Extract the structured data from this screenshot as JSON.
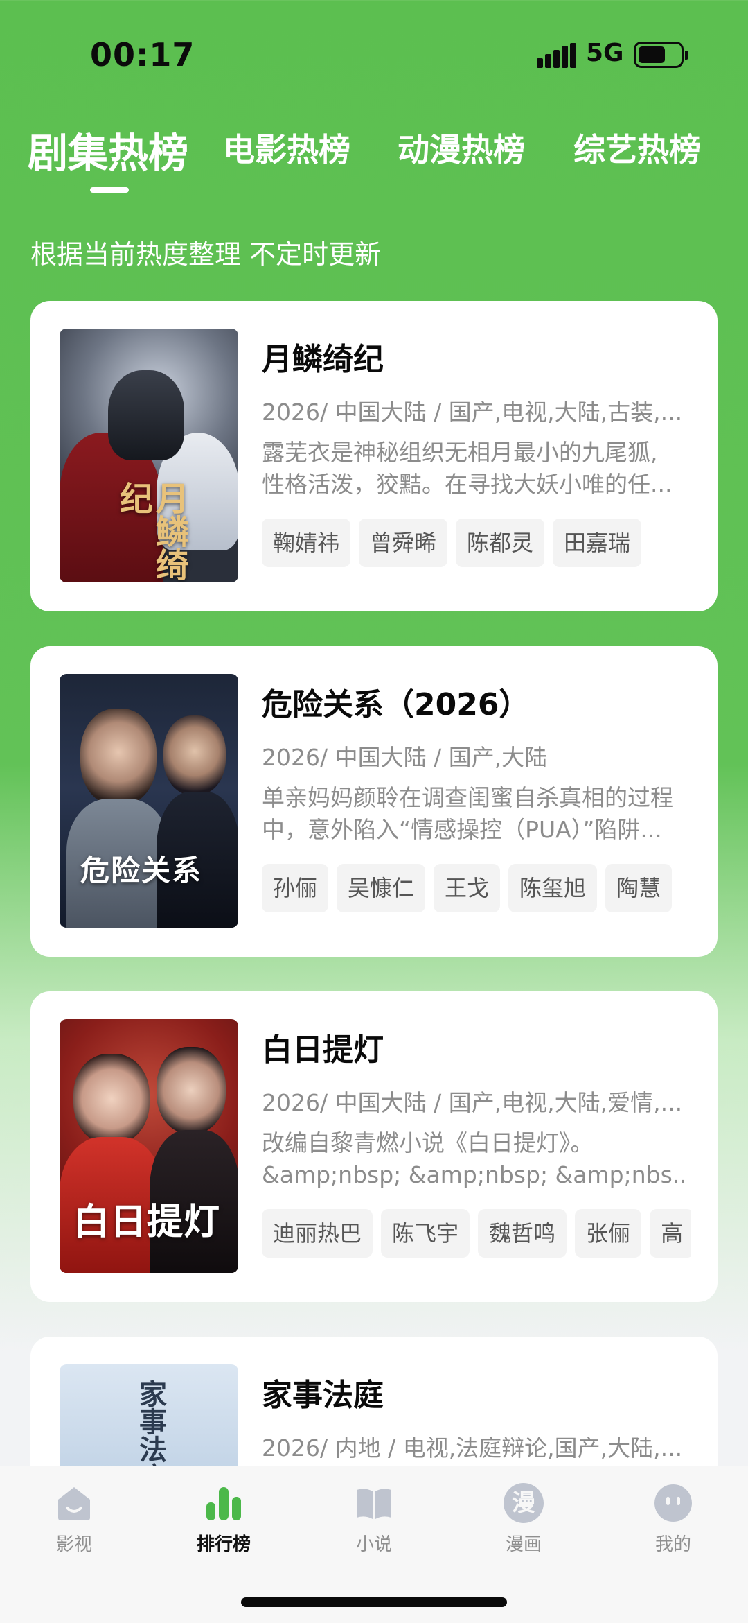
{
  "status_bar": {
    "time": "00:17",
    "network": "5G"
  },
  "tabs": [
    {
      "label": "剧集热榜",
      "active": true
    },
    {
      "label": "电影热榜",
      "active": false
    },
    {
      "label": "动漫热榜",
      "active": false
    },
    {
      "label": "综艺热榜",
      "active": false
    }
  ],
  "subtitle": "根据当前热度整理 不定时更新",
  "cards": [
    {
      "title": "月鳞绮纪",
      "meta": "2026/ 中国大陆 / 国产,电视,大陆,古装,...",
      "desc_line1": "露芜衣是神秘组织无相月最小的九尾狐,",
      "desc_line2": "性格活泼，狡黠。在寻找大妖小唯的任...",
      "poster_text": "月鳞绮纪",
      "tags": [
        "鞠婧祎",
        "曾舜晞",
        "陈都灵",
        "田嘉瑞"
      ]
    },
    {
      "title": "危险关系（2026）",
      "meta": "2026/ 中国大陆 / 国产,大陆",
      "desc_line1": "单亲妈妈颜聆在调查闺蜜自杀真相的过程",
      "desc_line2": "中，意外陷入“情感操控（PUA）”陷阱...",
      "poster_text": "危险关系",
      "tags": [
        "孙俪",
        "吴慷仁",
        "王戈",
        "陈玺旭",
        "陶慧"
      ]
    },
    {
      "title": "白日提灯",
      "meta": "2026/ 中国大陆 / 国产,电视,大陆,爱情,...",
      "desc_line1": "改编自黎青燃小说《白日提灯》。",
      "desc_line2": "&amp;nbsp; &amp;nbsp; &amp;nbs...",
      "poster_text": "白日提灯",
      "tags": [
        "迪丽热巴",
        "陈飞宇",
        "魏哲鸣",
        "张俪",
        "高"
      ]
    },
    {
      "title": "家事法庭",
      "meta": "2026/ 内地 / 电视,法庭辩论,国产,大陆,...",
      "desc_line1": "",
      "desc_line2": "",
      "poster_text": "家事法庭",
      "tags": []
    }
  ],
  "bottom_nav": [
    {
      "label": "影视",
      "icon": "home-icon",
      "active": false
    },
    {
      "label": "排行榜",
      "icon": "ranking-bars-icon",
      "active": true
    },
    {
      "label": "小说",
      "icon": "book-icon",
      "active": false
    },
    {
      "label": "漫画",
      "icon": "comic-icon",
      "active": false,
      "glyph": "漫"
    },
    {
      "label": "我的",
      "icon": "profile-face-icon",
      "active": false
    }
  ],
  "colors": {
    "brand_green": "#5cbf50",
    "active_nav_green": "#4cb84a",
    "inactive_icon": "#bfc4cf"
  }
}
